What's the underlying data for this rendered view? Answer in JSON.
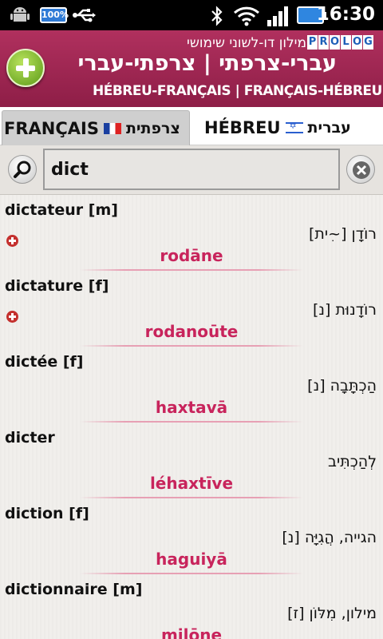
{
  "status_bar": {
    "battery_label": "100%",
    "time": "16:30",
    "icons": [
      "android-debug-icon",
      "battery-full-icon",
      "usb-icon",
      "bluetooth-icon",
      "wifi-icon",
      "signal-icon",
      "battery-icon"
    ]
  },
  "header": {
    "subtitle": "מילון דו-לשוני שימושי",
    "brand": [
      "P",
      "R",
      "O",
      "L",
      "O",
      "G"
    ],
    "title": "עברי-צרפתי | צרפתי-עברי",
    "latin_title": "HÉBREU-FRANÇAIS | FRANÇAIS-HÉBREU",
    "accent": "#9e2452"
  },
  "tabs": {
    "french_label": "FRANÇAIS",
    "french_hebrew": "צרפתית",
    "hebrew_label": "HÉBREU",
    "hebrew_hebrew": "עברית"
  },
  "search": {
    "value": "dict"
  },
  "entries": [
    {
      "headword": "dictateur [m]",
      "hebrew": "רוֹדָן [~ִית]",
      "translit": "rodāne",
      "has_plus": true
    },
    {
      "headword": "dictature [f]",
      "hebrew": "רוֹדָנוּת [נ]",
      "translit": "rodanoūte",
      "has_plus": true
    },
    {
      "headword": "dictée [f]",
      "hebrew": "הַכְתָּבָה [נ]",
      "translit": "haxtavā",
      "has_plus": false
    },
    {
      "headword": "dicter",
      "hebrew": "לְהַכְתִּיב",
      "translit": "léhaxtīve",
      "has_plus": false
    },
    {
      "headword": "diction [f]",
      "hebrew": "הגייה, הֲגִיָּה [נ]",
      "translit": "haguiyā",
      "has_plus": false
    },
    {
      "headword": "dictionnaire [m]",
      "hebrew": "מילון, מִלּוֹן [ז]",
      "translit": "milōne",
      "has_plus": false
    }
  ]
}
